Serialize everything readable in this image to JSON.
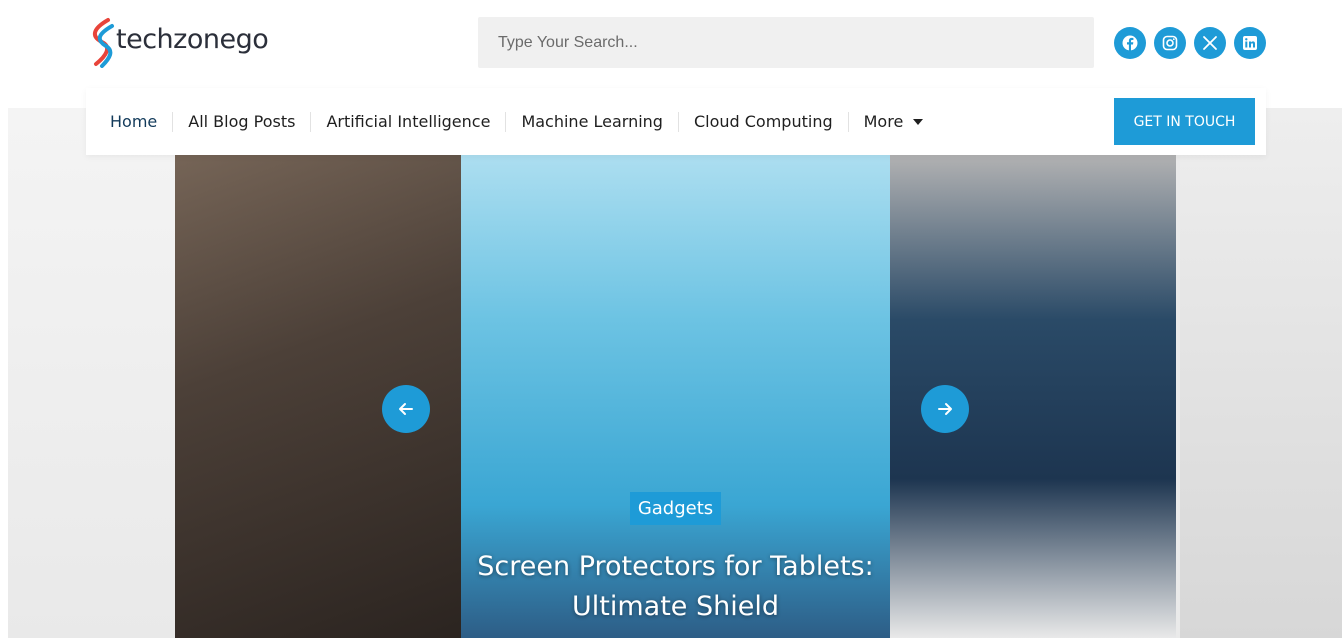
{
  "brand": {
    "name_main": "techzone",
    "name_suffix": "go",
    "accent": "#1e9bd7"
  },
  "search": {
    "placeholder": "Type Your Search..."
  },
  "socials": [
    {
      "icon": "facebook-icon"
    },
    {
      "icon": "instagram-icon"
    },
    {
      "icon": "x-icon"
    },
    {
      "icon": "linkedin-icon"
    }
  ],
  "nav": {
    "items": [
      {
        "label": "Home",
        "active": true
      },
      {
        "label": "All Blog Posts"
      },
      {
        "label": "Artificial Intelligence"
      },
      {
        "label": "Machine Learning"
      },
      {
        "label": "Cloud Computing"
      },
      {
        "label": "More"
      }
    ],
    "cta": "GET IN TOUCH"
  },
  "slider": {
    "active_slide": {
      "category": "Gadgets",
      "title": "Screen Protectors for Tablets: Ultimate Shield"
    }
  }
}
